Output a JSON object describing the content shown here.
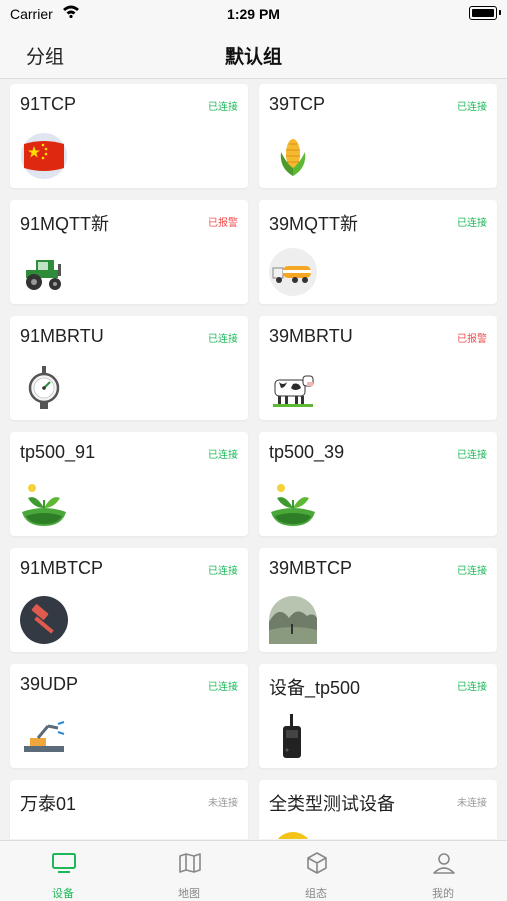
{
  "status_bar": {
    "carrier": "Carrier",
    "time": "1:29 PM"
  },
  "nav": {
    "left": "分组",
    "title": "默认组"
  },
  "devices": [
    {
      "name": "91TCP",
      "status": "已连接",
      "state": "ok",
      "icon": "china-flag-icon"
    },
    {
      "name": "39TCP",
      "status": "已连接",
      "state": "ok",
      "icon": "corn-icon"
    },
    {
      "name": "91MQTT新",
      "status": "已报警",
      "state": "alarm",
      "icon": "tractor-icon"
    },
    {
      "name": "39MQTT新",
      "status": "已连接",
      "state": "ok",
      "icon": "tanker-truck-icon"
    },
    {
      "name": "91MBRTU",
      "status": "已连接",
      "state": "ok",
      "icon": "pressure-gauge-icon"
    },
    {
      "name": "39MBRTU",
      "status": "已报警",
      "state": "alarm",
      "icon": "cow-icon"
    },
    {
      "name": "tp500_91",
      "status": "已连接",
      "state": "ok",
      "icon": "sprout-icon"
    },
    {
      "name": "tp500_39",
      "status": "已连接",
      "state": "ok",
      "icon": "sprout-icon"
    },
    {
      "name": "91MBTCP",
      "status": "已连接",
      "state": "ok",
      "icon": "hammer-icon"
    },
    {
      "name": "39MBTCP",
      "status": "已连接",
      "state": "ok",
      "icon": "landscape-photo-icon"
    },
    {
      "name": "39UDP",
      "status": "已连接",
      "state": "ok",
      "icon": "robot-arm-icon"
    },
    {
      "name": "设备_tp500",
      "status": "已连接",
      "state": "ok",
      "icon": "walkie-talkie-icon"
    },
    {
      "name": "万泰01",
      "status": "未连接",
      "state": "off",
      "icon": ""
    },
    {
      "name": "全类型测试设备",
      "status": "未连接",
      "state": "off",
      "icon": "partial-yellow-icon"
    }
  ],
  "tabs": [
    {
      "label": "设备",
      "icon": "monitor-icon",
      "active": true
    },
    {
      "label": "地图",
      "icon": "map-icon",
      "active": false
    },
    {
      "label": "组态",
      "icon": "cube-icon",
      "active": false
    },
    {
      "label": "我的",
      "icon": "user-icon",
      "active": false
    }
  ],
  "colors": {
    "accent": "#1eb85b",
    "alarm": "#f14c4c",
    "offline": "#999999"
  }
}
